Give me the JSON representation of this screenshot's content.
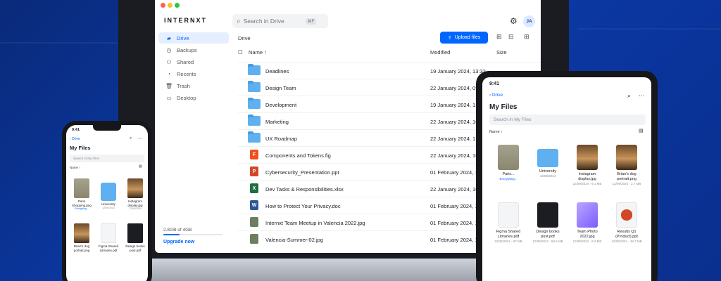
{
  "desktop": {
    "logo": "INTERNXT",
    "search": {
      "placeholder": "Search in Drive",
      "shortcut": "⌘F"
    },
    "avatar_initials": "JA",
    "sidebar": {
      "items": [
        {
          "label": "Drive",
          "icon": "folder-icon",
          "active": true
        },
        {
          "label": "Backups",
          "icon": "clock-icon"
        },
        {
          "label": "Shared",
          "icon": "users-icon"
        },
        {
          "label": "Recents",
          "icon": "recent-icon"
        },
        {
          "label": "Trash",
          "icon": "trash-icon"
        },
        {
          "label": "Desktop",
          "icon": "monitor-icon"
        }
      ],
      "storage_text": "2.8GB of 4GB",
      "storage_used_fraction": 0.27,
      "upgrade_label": "Upgrade now"
    },
    "main": {
      "breadcrumb": "Drive",
      "upload_label": "Upload files",
      "columns": {
        "name": "Name ↑",
        "modified": "Modified",
        "size": "Size"
      },
      "rows": [
        {
          "name": "Deadlines",
          "modified": "19 January 2024, 13:32",
          "type": "folder"
        },
        {
          "name": "Design Team",
          "modified": "22 January 2024, 09:29",
          "type": "shared-folder"
        },
        {
          "name": "Development",
          "modified": "19 January 2024, 13:34",
          "type": "folder"
        },
        {
          "name": "Marketing",
          "modified": "22 January 2024, 10:06",
          "type": "folder"
        },
        {
          "name": "UX Roadmap",
          "modified": "22 January 2024, 12:44",
          "type": "folder"
        },
        {
          "name": "Components and Tokens.fig",
          "modified": "22 January 2024, 10:06",
          "type": "figma"
        },
        {
          "name": "Cybersecurity_Presentation.ppt",
          "modified": "01 February 2024, 12:3",
          "type": "ppt"
        },
        {
          "name": "Dev Tasks & Responsibilities.xlsx",
          "modified": "22 January 2024, 10:06",
          "type": "xlsx"
        },
        {
          "name": "How to Protect Your Privacy.doc",
          "modified": "01 February 2024, 12:3",
          "type": "doc"
        },
        {
          "name": "Internxt Team Meetup in Valencia 2022.jpg",
          "modified": "01 February 2024, 12:3",
          "type": "photo"
        },
        {
          "name": "Valencia-Summer-02.jpg",
          "modified": "01 February 2024, 12:3",
          "type": "photo"
        }
      ]
    },
    "colors": {
      "accent": "#0066ff",
      "folder": "#5fb0f0",
      "background": "#0b3aa8"
    }
  },
  "tablet": {
    "time": "9:41",
    "back": "Drive",
    "title": "My Files",
    "search_placeholder": "Search in My Files",
    "sort": "Name ↑",
    "tiles": [
      {
        "name": "Paris...",
        "meta": "Encrypting...",
        "kind": "selfie"
      },
      {
        "name": "University",
        "meta": "12/09/2024",
        "kind": "folder"
      },
      {
        "name": "Instagram display.jpg",
        "meta": "12/09/2024 · 9.1 MB",
        "kind": "dog"
      },
      {
        "name": "Brian's dog portrait.png",
        "meta": "12/09/2024 · 2.7 MB",
        "kind": "dog"
      },
      {
        "name": "Figma Shared Libraries.pdf",
        "meta": "12/09/2024 · 87 MB",
        "kind": "doc"
      },
      {
        "name": "Design books post.pdf",
        "meta": "12/09/2024 · 59.5 MB",
        "kind": "dark"
      },
      {
        "name": "Team Photo 2022.jpg",
        "meta": "12/09/2024 · 9.2 MB",
        "kind": "purple"
      },
      {
        "name": "Results Q1 (Product).ppt",
        "meta": "12/09/2024 · 48.7 MB",
        "kind": "ppt"
      }
    ]
  },
  "phone": {
    "time": "9:41",
    "back": "Drive",
    "title": "My Files",
    "search_placeholder": "Search in My Files",
    "sort": "Name ↑",
    "tiles": [
      {
        "name": "Paris Shopping.png",
        "meta": "Encrypting...",
        "kind": "selfie"
      },
      {
        "name": "University",
        "meta": "12/09/2024",
        "kind": "folder"
      },
      {
        "name": "Instagram display.jpg",
        "meta": "12/09/2024",
        "kind": "dog"
      },
      {
        "name": "Brian's dog portrait.png",
        "meta": "",
        "kind": "dog"
      },
      {
        "name": "Figma Shared Libraries.pdf",
        "meta": "",
        "kind": "doc"
      },
      {
        "name": "Design books post.pdf",
        "meta": "",
        "kind": "dark"
      }
    ]
  }
}
